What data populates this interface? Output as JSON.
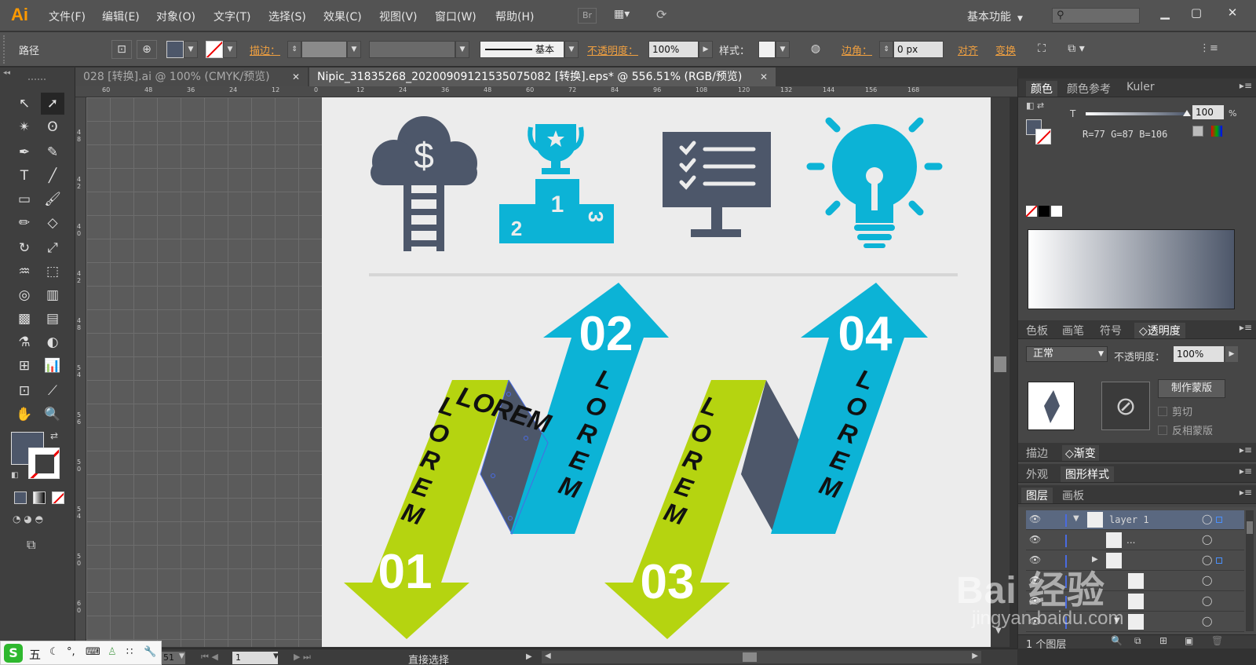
{
  "app": {
    "logo": "Ai",
    "menu": [
      "文件(F)",
      "编辑(E)",
      "对象(O)",
      "文字(T)",
      "选择(S)",
      "效果(C)",
      "视图(V)",
      "窗口(W)",
      "帮助(H)"
    ],
    "bridge_label": "Br",
    "workspace": "基本功能",
    "colors": {
      "accent_orange": "#ff9a00",
      "ui_dark": "#535353"
    }
  },
  "controlbar": {
    "selection_type": "路径",
    "stroke_label": "描边：",
    "stroke_style": "基本",
    "opacity_label": "不透明度：",
    "opacity_value": "100%",
    "style_label": "样式：",
    "corner_label": "边角：",
    "corner_value": "0 px",
    "align_label": "对齐",
    "transform_label": "变换"
  },
  "tabs": [
    {
      "label": "028 [转换].ai @ 100% (CMYK/预览)",
      "active": false
    },
    {
      "label": "Nipic_31835268_20200909121535075082 [转换].eps* @ 556.51% (RGB/预览)",
      "active": true
    }
  ],
  "ruler": {
    "top": [
      "60",
      "48",
      "36",
      "24",
      "12",
      "0",
      "12",
      "24",
      "36",
      "48",
      "60",
      "72",
      "84",
      "96",
      "108",
      "120",
      "132",
      "144",
      "156",
      "168"
    ],
    "left": [
      "4 8",
      "4 2",
      "4 0",
      "4 2",
      "4 8",
      "5 4",
      "5 6",
      "5 0",
      "5 4",
      "5 0",
      "6 0"
    ]
  },
  "artwork": {
    "steps": [
      {
        "number": "01",
        "label": "LOREM",
        "color": "#b5d410"
      },
      {
        "number": "02",
        "label": "LOREM",
        "color": "#0cb3d6"
      },
      {
        "number": "03",
        "label": "LOREM",
        "color": "#b5d410"
      },
      {
        "number": "04",
        "label": "LOREM",
        "color": "#0cb3d6"
      }
    ],
    "fold_color": "#4d576a",
    "icon_dark": "#4d576a",
    "icon_blue": "#0cb3d6",
    "podium_numbers": [
      "1",
      "2",
      "3"
    ],
    "money_symbol": "$"
  },
  "panels": {
    "color": {
      "tabs": [
        "颜色",
        "颜色参考",
        "Kuler"
      ],
      "t_label": "T",
      "t_value": "100",
      "t_unit": "%",
      "rgb_readout": "R=77 G=87 B=106"
    },
    "transparency": {
      "tabs": [
        "色板",
        "画笔",
        "符号",
        "透明度"
      ],
      "blend_mode": "正常",
      "opacity_label": "不透明度：",
      "opacity_value": "100%",
      "make_mask_button": "制作蒙版",
      "clip_label": "剪切",
      "invert_label": "反相蒙版"
    },
    "stroke_gradient": {
      "tabs": [
        "描边",
        "渐变"
      ]
    },
    "appearance": {
      "tabs": [
        "外观",
        "图形样式"
      ]
    },
    "layers": {
      "tabs": [
        "图层",
        "画板"
      ],
      "rows": [
        {
          "name": "layer 1"
        },
        {
          "name": "..."
        },
        {
          "name": ""
        },
        {
          "name": ""
        },
        {
          "name": ""
        },
        {
          "name": ""
        }
      ],
      "footer": "1 个图层"
    }
  },
  "statusbar": {
    "zoom": "51",
    "page": "1",
    "tool_name": "直接选择"
  },
  "ime": {
    "logo": "S",
    "mode": "五"
  },
  "watermark": {
    "text": "Bai 经验",
    "sub": "jingyan.baidu.com"
  }
}
